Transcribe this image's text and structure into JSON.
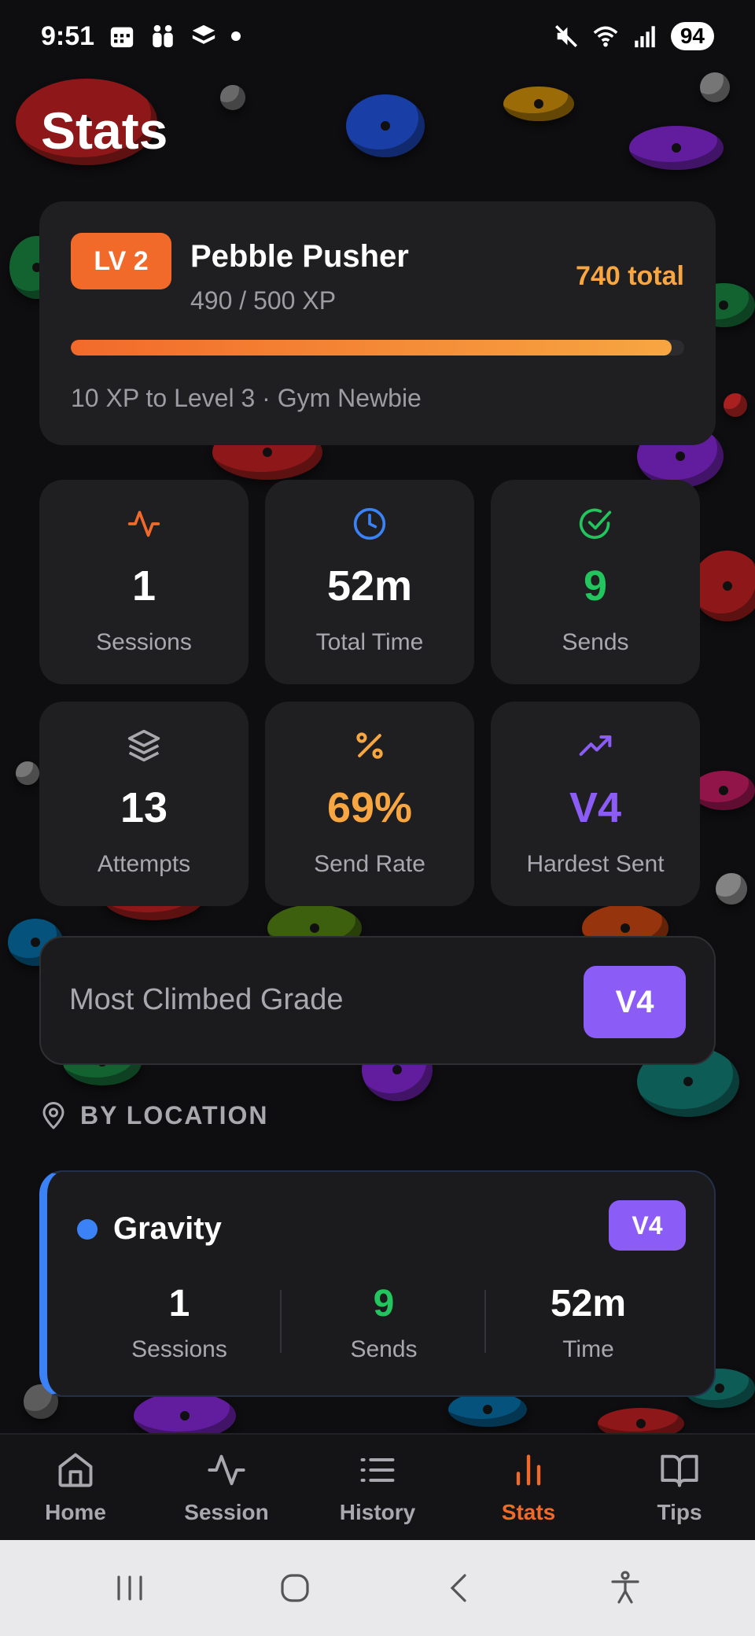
{
  "status_bar": {
    "time": "9:51",
    "battery": "94"
  },
  "page": {
    "title": "Stats"
  },
  "level": {
    "badge": "LV 2",
    "name": "Pebble Pusher",
    "xp": "490 / 500 XP",
    "total": "740 total",
    "progress_fraction": 0.98,
    "next": "10 XP to Level 3 · Gym Newbie"
  },
  "tiles": [
    {
      "icon": "activity-icon",
      "value": "1",
      "label": "Sessions",
      "color": "#f26a2a",
      "value_color": "#ffffff"
    },
    {
      "icon": "clock-icon",
      "value": "52m",
      "label": "Total Time",
      "color": "#3b82f6",
      "value_color": "#ffffff"
    },
    {
      "icon": "check-circle-icon",
      "value": "9",
      "label": "Sends",
      "color": "#22c55e",
      "value_color": "#22c55e"
    },
    {
      "icon": "layers-icon",
      "value": "13",
      "label": "Attempts",
      "color": "#a8a8ae",
      "value_color": "#ffffff"
    },
    {
      "icon": "percent-icon",
      "value": "69%",
      "label": "Send Rate",
      "color": "#f7a642",
      "value_color": "#f7a642"
    },
    {
      "icon": "trending-up-icon",
      "value": "V4",
      "label": "Hardest Sent",
      "color": "#8b5cf6",
      "value_color": "#8b5cf6"
    }
  ],
  "most_climbed": {
    "label": "Most Climbed Grade",
    "grade": "V4"
  },
  "by_location": {
    "heading": "BY LOCATION",
    "locations": [
      {
        "name": "Gravity",
        "grade": "V4",
        "sessions_value": "1",
        "sessions_label": "Sessions",
        "sends_value": "9",
        "sends_label": "Sends",
        "time_value": "52m",
        "time_label": "Time"
      }
    ]
  },
  "nav": {
    "items": [
      {
        "label": "Home",
        "icon": "home-icon"
      },
      {
        "label": "Session",
        "icon": "activity-icon"
      },
      {
        "label": "History",
        "icon": "list-icon"
      },
      {
        "label": "Stats",
        "icon": "bar-chart-icon",
        "active": true
      },
      {
        "label": "Tips",
        "icon": "book-icon"
      }
    ]
  },
  "colors": {
    "accent": "#f26a2a",
    "gold": "#f7a642",
    "purple": "#8b5cf6",
    "blue": "#3b82f6",
    "green": "#22c55e"
  }
}
